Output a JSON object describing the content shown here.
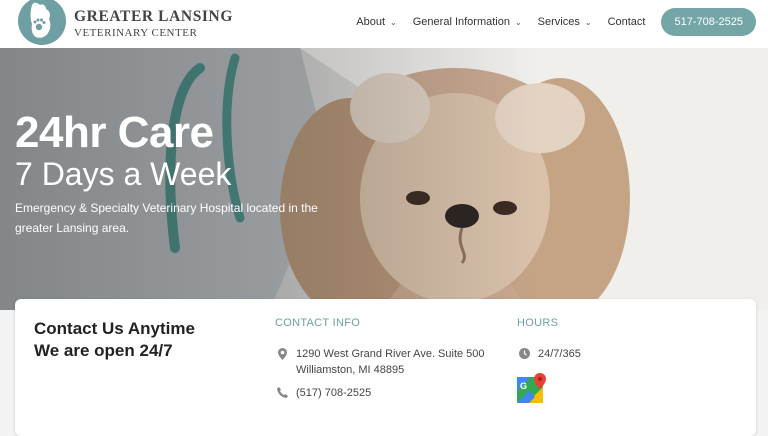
{
  "header": {
    "logo_line1": "GREATER LANSING",
    "logo_line2": "VETERINARY CENTER",
    "nav": [
      {
        "label": "About",
        "has_dropdown": true
      },
      {
        "label": "General Information",
        "has_dropdown": true
      },
      {
        "label": "Services",
        "has_dropdown": true
      },
      {
        "label": "Contact",
        "has_dropdown": false
      }
    ],
    "phone_button": "517-708-2525"
  },
  "hero": {
    "title": "24hr Care",
    "subtitle": "7 Days a Week",
    "description": "Emergency & Specialty Veterinary Hospital located in the greater Lansing area."
  },
  "contact": {
    "heading_line1": "Contact Us Anytime",
    "heading_line2": "We are open 24/7",
    "info_title": "CONTACT INFO",
    "address_line1": "1290 West Grand River Ave. Suite 500",
    "address_line2": "Williamston, MI 48895",
    "phone": "(517) 708-2525",
    "hours_title": "HOURS",
    "hours": "24/7/365"
  },
  "colors": {
    "accent": "#74a6a8",
    "title_teal": "#6e9fa3"
  },
  "icons": [
    "michigan-paw-logo-icon",
    "chevron-down-icon",
    "map-pin-icon",
    "phone-icon",
    "clock-icon",
    "google-maps-icon"
  ]
}
